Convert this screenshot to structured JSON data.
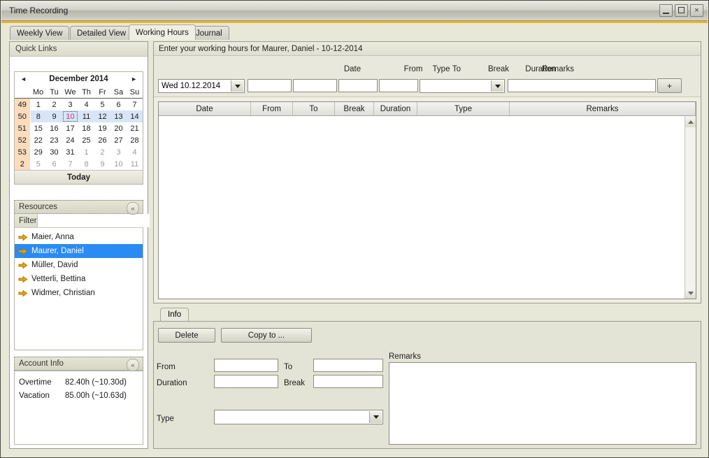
{
  "window": {
    "title": "Time Recording",
    "minimize_label": "minimize",
    "maximize_label": "maximize",
    "close_label": "×"
  },
  "tabs": [
    {
      "label": "Weekly View",
      "active": false
    },
    {
      "label": "Detailed View",
      "active": false
    },
    {
      "label": "Working Hours",
      "active": true
    },
    {
      "label": "Journal",
      "active": false
    }
  ],
  "sidebar": {
    "quick_links_title": "Quick Links",
    "calendar": {
      "prev_arrow": "◄",
      "next_arrow": "►",
      "title": "December 2014",
      "week_col_header": "",
      "day_headers": [
        "Mo",
        "Tu",
        "We",
        "Th",
        "Fr",
        "Sa",
        "Su"
      ],
      "weeks": [
        {
          "week": "49",
          "selected_row": false,
          "days": [
            {
              "n": "1",
              "other": false,
              "sel": false
            },
            {
              "n": "2",
              "other": false,
              "sel": false
            },
            {
              "n": "3",
              "other": false,
              "sel": false
            },
            {
              "n": "4",
              "other": false,
              "sel": false
            },
            {
              "n": "5",
              "other": false,
              "sel": false
            },
            {
              "n": "6",
              "other": false,
              "sel": false
            },
            {
              "n": "7",
              "other": false,
              "sel": false
            }
          ]
        },
        {
          "week": "50",
          "selected_row": true,
          "days": [
            {
              "n": "8",
              "other": false,
              "sel": false
            },
            {
              "n": "9",
              "other": false,
              "sel": false
            },
            {
              "n": "10",
              "other": false,
              "sel": true
            },
            {
              "n": "11",
              "other": false,
              "sel": false
            },
            {
              "n": "12",
              "other": false,
              "sel": false
            },
            {
              "n": "13",
              "other": false,
              "sel": false
            },
            {
              "n": "14",
              "other": false,
              "sel": false
            }
          ]
        },
        {
          "week": "51",
          "selected_row": false,
          "days": [
            {
              "n": "15",
              "other": false,
              "sel": false
            },
            {
              "n": "16",
              "other": false,
              "sel": false
            },
            {
              "n": "17",
              "other": false,
              "sel": false
            },
            {
              "n": "18",
              "other": false,
              "sel": false
            },
            {
              "n": "19",
              "other": false,
              "sel": false
            },
            {
              "n": "20",
              "other": false,
              "sel": false
            },
            {
              "n": "21",
              "other": false,
              "sel": false
            }
          ]
        },
        {
          "week": "52",
          "selected_row": false,
          "days": [
            {
              "n": "22",
              "other": false,
              "sel": false
            },
            {
              "n": "23",
              "other": false,
              "sel": false
            },
            {
              "n": "24",
              "other": false,
              "sel": false
            },
            {
              "n": "25",
              "other": false,
              "sel": false
            },
            {
              "n": "26",
              "other": false,
              "sel": false
            },
            {
              "n": "27",
              "other": false,
              "sel": false
            },
            {
              "n": "28",
              "other": false,
              "sel": false
            }
          ]
        },
        {
          "week": "53",
          "selected_row": false,
          "days": [
            {
              "n": "29",
              "other": false,
              "sel": false
            },
            {
              "n": "30",
              "other": false,
              "sel": false
            },
            {
              "n": "31",
              "other": false,
              "sel": false
            },
            {
              "n": "1",
              "other": true,
              "sel": false
            },
            {
              "n": "2",
              "other": true,
              "sel": false
            },
            {
              "n": "3",
              "other": true,
              "sel": false
            },
            {
              "n": "4",
              "other": true,
              "sel": false
            }
          ]
        },
        {
          "week": "2",
          "selected_row": false,
          "days": [
            {
              "n": "5",
              "other": true,
              "sel": false
            },
            {
              "n": "6",
              "other": true,
              "sel": false
            },
            {
              "n": "7",
              "other": true,
              "sel": false
            },
            {
              "n": "8",
              "other": true,
              "sel": false
            },
            {
              "n": "9",
              "other": true,
              "sel": false
            },
            {
              "n": "10",
              "other": true,
              "sel": false
            },
            {
              "n": "11",
              "other": true,
              "sel": false
            }
          ]
        }
      ],
      "today_label": "Today"
    },
    "resources": {
      "title": "Resources",
      "collapse_icon": "«",
      "filter_label": "Filter",
      "filter_value": "",
      "filter_placeholder": "",
      "items": [
        {
          "label": "Maier, Anna",
          "selected": false
        },
        {
          "label": "Maurer, Daniel",
          "selected": true
        },
        {
          "label": "Müller, David",
          "selected": false
        },
        {
          "label": "Vetterli, Bettina",
          "selected": false
        },
        {
          "label": "Widmer, Christian",
          "selected": false
        }
      ]
    },
    "account_info": {
      "title": "Account Info",
      "collapse_icon": "«",
      "rows": [
        {
          "label": "Overtime",
          "value": "82.40h (~10.30d)"
        },
        {
          "label": "Vacation",
          "value": "85.00h (~10.63d)"
        }
      ]
    }
  },
  "main": {
    "header": "Enter your working hours for Maurer, Daniel - 10-12-2014",
    "entry_form": {
      "labels": {
        "date": "Date",
        "from": "From",
        "to": "To",
        "break": "Break",
        "duration": "Duration",
        "type": "Type",
        "remarks": "Remarks"
      },
      "date_value": "Wed 10.12.2014",
      "from_value": "",
      "to_value": "",
      "break_value": "",
      "duration_value": "",
      "type_value": "",
      "remarks_value": "",
      "add_button_label": "+"
    },
    "grid": {
      "columns": [
        "Date",
        "From",
        "To",
        "Break",
        "Duration",
        "Type",
        "Remarks"
      ],
      "rows": []
    }
  },
  "info_panel": {
    "tab_label": "Info",
    "delete_button": "Delete",
    "copy_to_button": "Copy to ...",
    "labels": {
      "from": "From",
      "to": "To",
      "duration": "Duration",
      "break": "Break",
      "type": "Type",
      "remarks": "Remarks"
    },
    "values": {
      "from": "",
      "to": "",
      "duration": "",
      "break": "",
      "type": "",
      "remarks": ""
    }
  },
  "colors": {
    "accent": "#f0b323",
    "selection": "#2a8bf2",
    "week_col": "#fbdcbc",
    "selected_week_row": "#d7e5f7",
    "selected_day_text": "#d52b8f",
    "arrow_icon": "#f0a500"
  }
}
